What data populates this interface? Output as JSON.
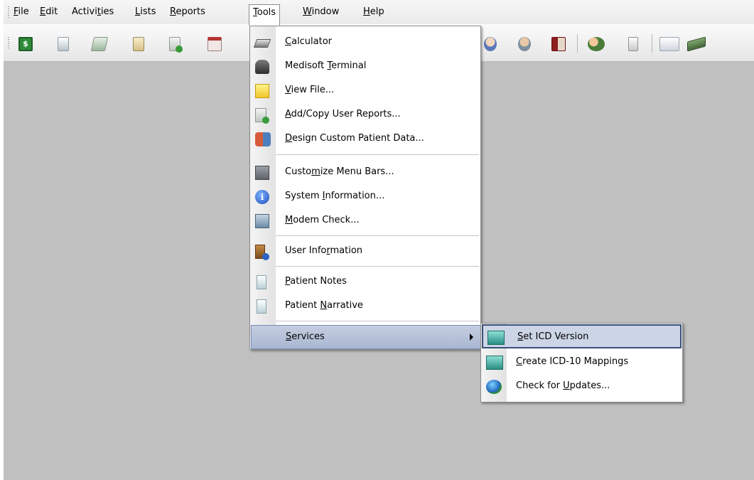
{
  "menubar": {
    "items": [
      {
        "label": "File",
        "mn": 0
      },
      {
        "label": "Edit",
        "mn": 0
      },
      {
        "label": "Activities",
        "mn": 6
      },
      {
        "label": "Lists",
        "mn": 0
      },
      {
        "label": "Reports",
        "mn": 0
      },
      {
        "label": "Tools",
        "mn": 0
      },
      {
        "label": "Window",
        "mn": 0
      },
      {
        "label": "Help",
        "mn": 0
      }
    ],
    "open_menu": "Tools"
  },
  "toolbar": {
    "buttons": [
      "transaction-entry-icon",
      "claim-icon",
      "statement-icon",
      "reports-icon",
      "user-report-icon",
      "appointment-icon",
      "doctor-icon",
      "provider-icon",
      "book-icon",
      "patients-icon",
      "door-icon",
      "quick-ledger-icon",
      "payment-icon"
    ]
  },
  "tools_menu": {
    "items": [
      {
        "label": "Calculator",
        "mn": 0,
        "icon": "calculator-icon"
      },
      {
        "label": "Medisoft Terminal",
        "mn": 9,
        "icon": "telephone-icon"
      },
      {
        "label": "View File...",
        "mn": 0,
        "icon": "note-icon"
      },
      {
        "label": "Add/Copy User Reports...",
        "mn": 0,
        "icon": "report-add-icon"
      },
      {
        "label": "Design Custom Patient Data...",
        "mn": 0,
        "icon": "custom-patient-icon"
      },
      {
        "label": "Customize Menu Bars...",
        "mn": 5,
        "icon": "menu-bar-icon"
      },
      {
        "label": "System Information...",
        "mn": 7,
        "icon": "info-icon"
      },
      {
        "label": "Modem  Check...",
        "mn": 0,
        "icon": "modem-icon"
      },
      {
        "label": "User Information",
        "mn": 9,
        "icon": "user-door-icon"
      },
      {
        "label": "Patient Notes",
        "mn": 0,
        "icon": "notes-icon"
      },
      {
        "label": "Patient Narrative",
        "mn": 8,
        "icon": "narrative-icon"
      },
      {
        "label": "Services",
        "mn": 0,
        "icon": ""
      }
    ]
  },
  "services_menu": {
    "items": [
      {
        "label": "Set ICD Version",
        "mn": 0,
        "icon": "icd-version-icon"
      },
      {
        "label": "Create ICD-10 Mappings",
        "mn": 0,
        "icon": "icd-mapping-icon"
      },
      {
        "label": "Check for Updates...",
        "mn": 10,
        "icon": "globe-update-icon"
      }
    ]
  },
  "colors": {
    "workspace": "#c0c0c0",
    "highlight": "#b8c3da",
    "highlight_border": "#3a4f78"
  }
}
